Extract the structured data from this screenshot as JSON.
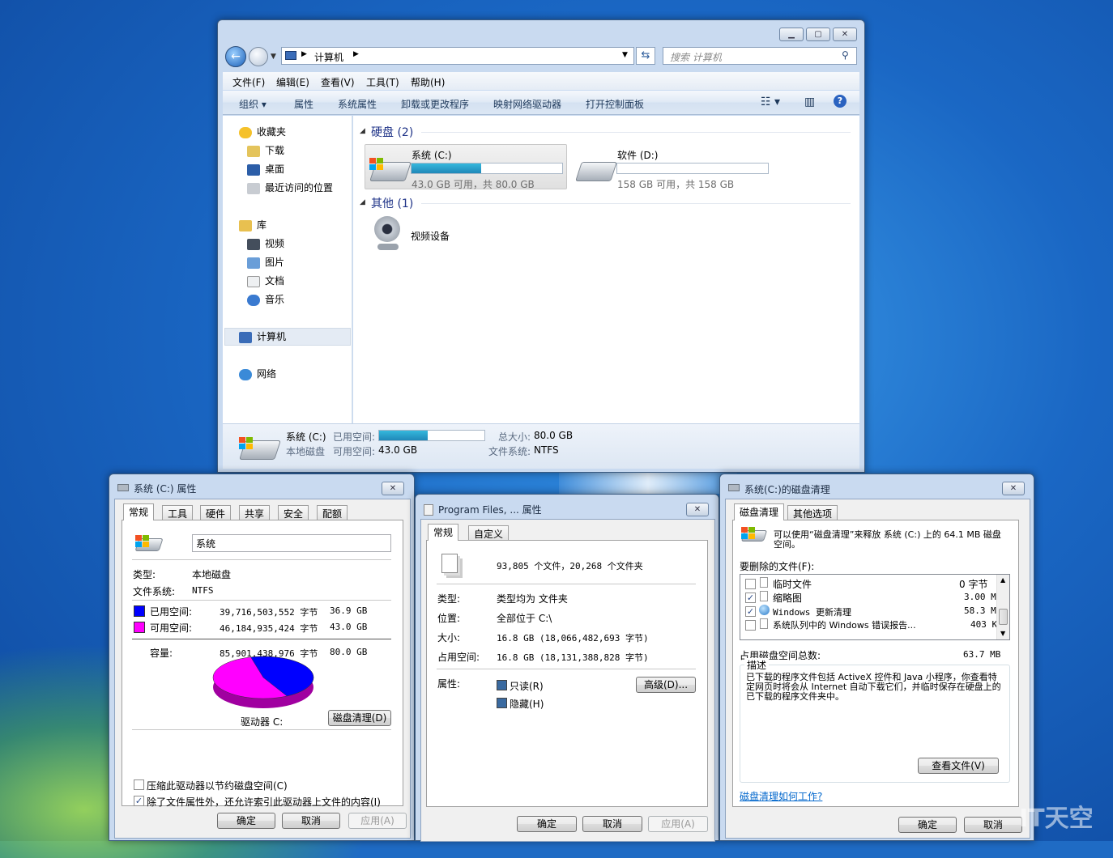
{
  "explorer": {
    "breadcrumb": "计算机",
    "search_placeholder": "搜索 计算机",
    "menu": [
      "文件(F)",
      "编辑(E)",
      "查看(V)",
      "工具(T)",
      "帮助(H)"
    ],
    "commands": [
      "组织 ▾",
      "属性",
      "系统属性",
      "卸载或更改程序",
      "映射网络驱动器",
      "打开控制面板"
    ],
    "nav": {
      "favorites": "收藏夹",
      "downloads": "下载",
      "desktop": "桌面",
      "recent": "最近访问的位置",
      "libraries": "库",
      "videos": "视频",
      "pictures": "图片",
      "documents": "文档",
      "music": "音乐",
      "computer": "计算机",
      "network": "网络"
    },
    "groups": {
      "hdd": "硬盘 (2)",
      "other": "其他 (1)"
    },
    "drives": [
      {
        "name": "系统 (C:)",
        "info": "43.0 GB 可用，共 80.0 GB",
        "used_fraction": 0.46
      },
      {
        "name": "软件 (D:)",
        "info": "158 GB 可用，共 158 GB",
        "used_fraction": 0.0
      }
    ],
    "device": "视频设备",
    "details": {
      "name": "系统 (C:)",
      "type": "本地磁盘",
      "used_label": "已用空间:",
      "free_label": "可用空间:",
      "free_value": "43.0 GB",
      "total_label": "总大小:",
      "total_value": "80.0 GB",
      "fs_label": "文件系统:",
      "fs_value": "NTFS",
      "used_fraction": 0.46
    }
  },
  "props_c": {
    "title": "系统 (C:) 属性",
    "tabs": [
      "常规",
      "工具",
      "硬件",
      "共享",
      "安全",
      "配额"
    ],
    "label_value": "系统",
    "type_label": "类型:",
    "type_value": "本地磁盘",
    "fs_label": "文件系统:",
    "fs_value": "NTFS",
    "used_label": "已用空间:",
    "used_bytes": "39,716,503,552 字节",
    "used_gb": "36.9 GB",
    "free_label": "可用空间:",
    "free_bytes": "46,184,935,424 字节",
    "free_gb": "43.0 GB",
    "cap_label": "容量:",
    "cap_bytes": "85,901,438,976 字节",
    "cap_gb": "80.0 GB",
    "drive_label": "驱动器 C:",
    "cleanup_button": "磁盘清理(D)",
    "compress": "压缩此驱动器以节约磁盘空间(C)",
    "index": "除了文件属性外，还允许索引此驱动器上文件的内容(I)",
    "ok": "确定",
    "cancel": "取消",
    "apply": "应用(A)",
    "used_color": "#0000ff",
    "free_color": "#ff00ff",
    "used_fraction": 0.462
  },
  "props_pf": {
    "title": "Program Files, ... 属性",
    "tabs": [
      "常规",
      "自定义"
    ],
    "count": "93,805 个文件，20,268 个文件夹",
    "type_label": "类型:",
    "type_value": "类型均为 文件夹",
    "loc_label": "位置:",
    "loc_value": "全部位于 C:\\",
    "size_label": "大小:",
    "size_value": "16.8 GB (18,066,482,693 字节)",
    "disk_label": "占用空间:",
    "disk_value": "16.8 GB (18,131,388,828 字节)",
    "attr_label": "属性:",
    "readonly": "只读(R)",
    "hidden": "隐藏(H)",
    "advanced": "高级(D)...",
    "ok": "确定",
    "cancel": "取消",
    "apply": "应用(A)"
  },
  "cleanup": {
    "title": "系统(C:)的磁盘清理",
    "tabs": [
      "磁盘清理",
      "其他选项"
    ],
    "intro": "可以使用“磁盘清理”来释放 系统 (C:) 上的 64.1 MB 磁盘空间。",
    "files_label": "要删除的文件(F):",
    "items": [
      {
        "name": "临时文件",
        "size": "0 字节",
        "checked": false
      },
      {
        "name": "缩略图",
        "size": "3.00 MB",
        "checked": true
      },
      {
        "name": "Windows 更新清理",
        "size": "58.3 MB",
        "checked": true
      },
      {
        "name": "系统队列中的 Windows 错误报告...",
        "size": "403 KB",
        "checked": false
      }
    ],
    "total_label": "占用磁盘空间总数:",
    "total_value": "63.7 MB",
    "desc_label": "描述",
    "desc_text": "已下载的程序文件包括 ActiveX 控件和 Java 小程序，你查看特定网页时将会从 Internet 自动下载它们，并临时保存在硬盘上的已下载的程序文件夹中。",
    "view_files": "查看文件(V)",
    "help_link": "磁盘清理如何工作?",
    "ok": "确定",
    "cancel": "取消"
  },
  "watermark": "IT天空"
}
